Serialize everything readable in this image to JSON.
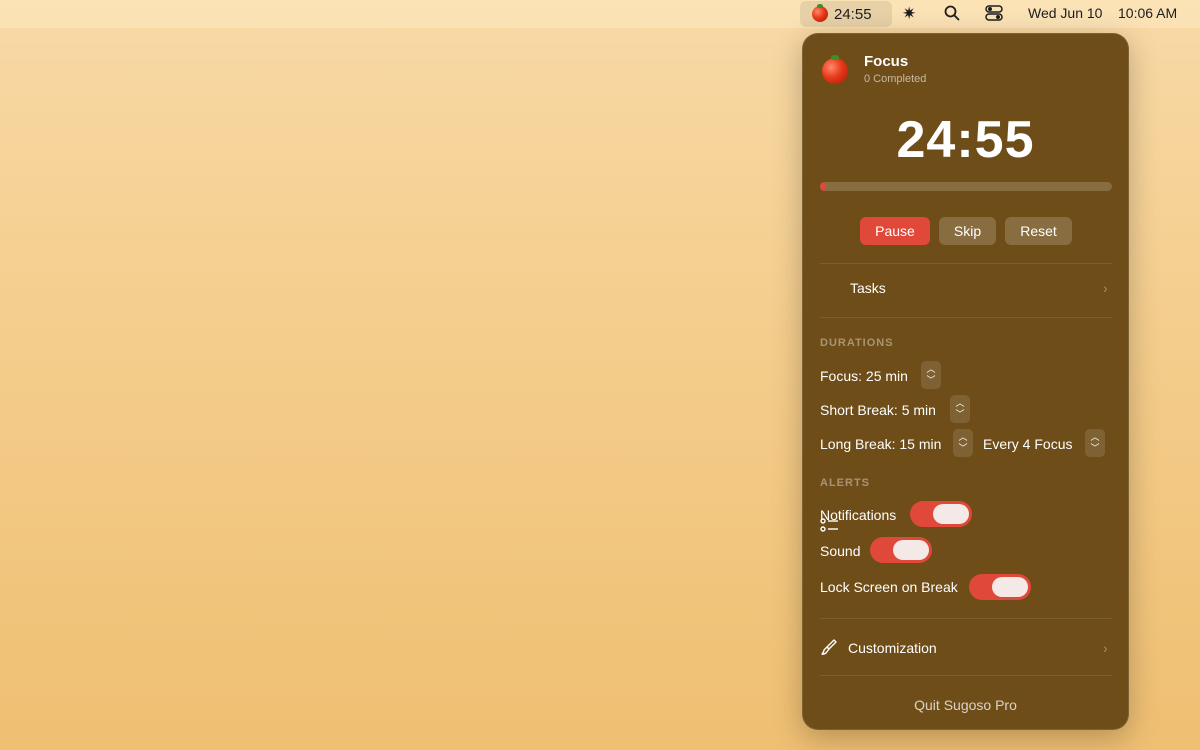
{
  "menubar": {
    "timer": "24:55",
    "date": "Wed Jun 10",
    "time": "10:06 AM",
    "icons": [
      "tomato-icon",
      "brightness-icon",
      "search-icon",
      "control-center-icon"
    ]
  },
  "panel": {
    "title": "Focus",
    "subtitle": "0 Completed",
    "timer": "24:55",
    "progress": 0.02,
    "buttons": {
      "pause": "Pause",
      "skip": "Skip",
      "reset": "Reset"
    },
    "tasks_label": "Tasks",
    "durations": {
      "section": "DURATIONS",
      "focus": "Focus: 25 min",
      "short_break": "Short Break: 5 min",
      "long_break": "Long Break: 15 min",
      "every": "Every 4 Focus"
    },
    "alerts": {
      "section": "ALERTS",
      "notifications": {
        "label": "Notifications",
        "on": true
      },
      "sound": {
        "label": "Sound",
        "on": true
      },
      "lock_screen": {
        "label": "Lock Screen on Break",
        "on": true
      }
    },
    "customization_label": "Customization",
    "quit_label": "Quit Sugoso Pro"
  },
  "colors": {
    "accent": "#e0483a",
    "panel_bg": "#6e4d18",
    "desktop_top": "#f8d9a6",
    "desktop_bottom": "#efbf72"
  }
}
